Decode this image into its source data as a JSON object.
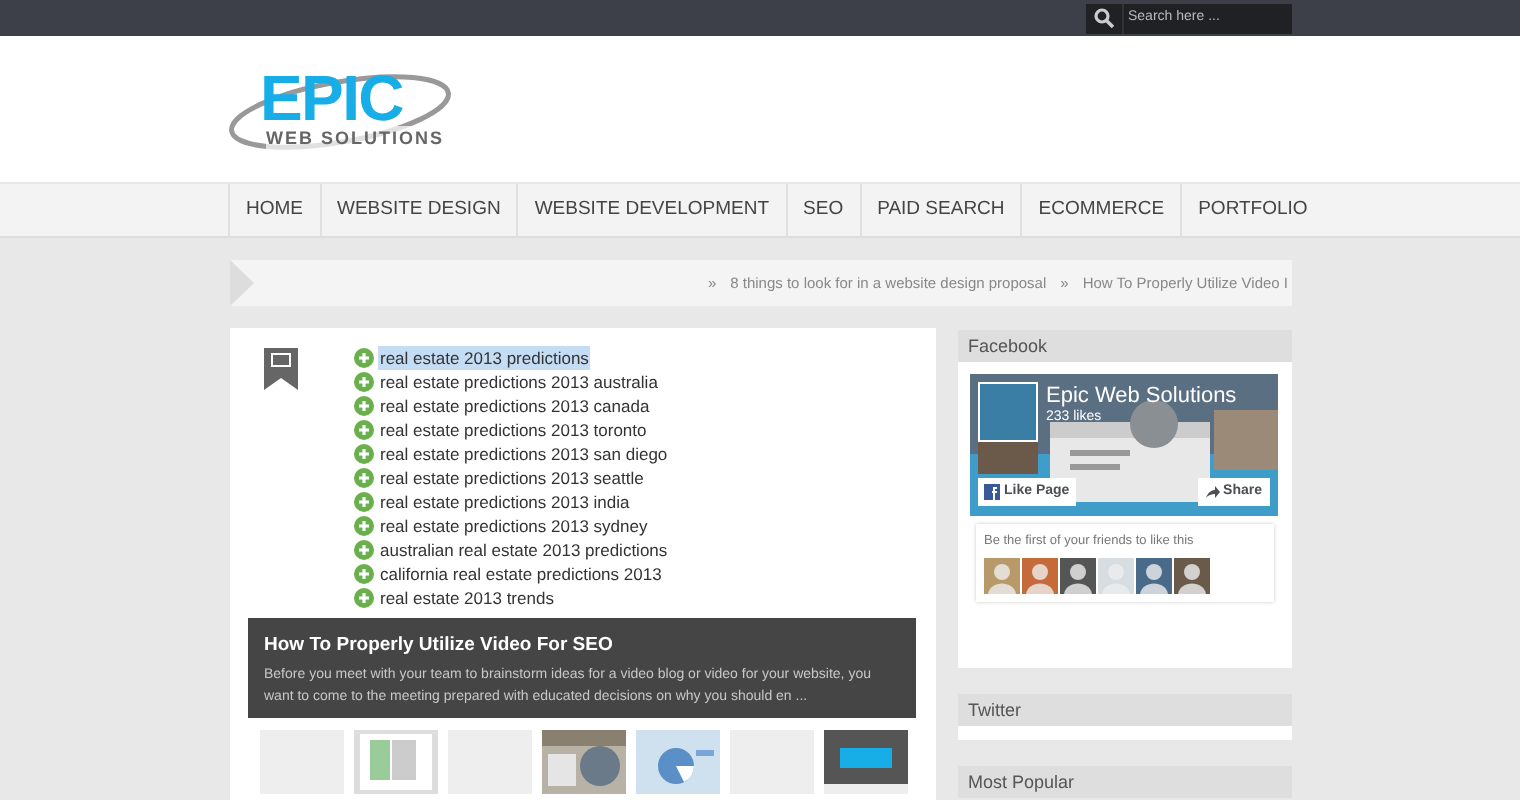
{
  "search": {
    "placeholder": "Search here ..."
  },
  "logo": {
    "mark": "EPIC",
    "tagline": "WEB SOLUTIONS"
  },
  "nav": [
    {
      "label": "HOME"
    },
    {
      "label": "WEBSITE DESIGN"
    },
    {
      "label": "WEBSITE DEVELOPMENT"
    },
    {
      "label": "SEO"
    },
    {
      "label": "PAID SEARCH"
    },
    {
      "label": "ECOMMERCE"
    },
    {
      "label": "PORTFOLIO"
    }
  ],
  "ticker": [
    {
      "bullet": "»",
      "text": "8 things to look for in a website design proposal"
    },
    {
      "bullet": "»",
      "text": "How To Properly Utilize Video I"
    }
  ],
  "post": {
    "keywords": [
      {
        "text": "real estate 2013 predictions",
        "selected": true
      },
      {
        "text": "real estate predictions 2013 australia",
        "selected": false
      },
      {
        "text": "real estate predictions 2013 canada",
        "selected": false
      },
      {
        "text": "real estate predictions 2013 toronto",
        "selected": false
      },
      {
        "text": "real estate predictions 2013 san diego",
        "selected": false
      },
      {
        "text": "real estate predictions 2013 seattle",
        "selected": false
      },
      {
        "text": "real estate predictions 2013 india",
        "selected": false
      },
      {
        "text": "real estate predictions 2013 sydney",
        "selected": false
      },
      {
        "text": "australian real estate 2013 predictions",
        "selected": false
      },
      {
        "text": "california real estate predictions 2013",
        "selected": false
      },
      {
        "text": "real estate 2013 trends",
        "selected": false
      }
    ],
    "title": "How To Properly Utilize Video For SEO",
    "excerpt": "Before you meet with your team to brainstorm ideas for a video blog or video for your website, you want to come to the meeting prepared with educated decisions on why you should en ...",
    "thumbnails": [
      {
        "kind": "blank"
      },
      {
        "kind": "document"
      },
      {
        "kind": "blank"
      },
      {
        "kind": "picture"
      },
      {
        "kind": "chart"
      },
      {
        "kind": "blank"
      },
      {
        "kind": "logo"
      }
    ]
  },
  "sidebar": {
    "facebook": {
      "heading": "Facebook",
      "page_name": "Epic Web Solutions",
      "likes": "233 likes",
      "like_button": "Like Page",
      "share_button": "Share",
      "friends_text": "Be the first of your friends to like this"
    },
    "twitter": {
      "heading": "Twitter"
    },
    "popular": {
      "heading": "Most Popular"
    }
  }
}
